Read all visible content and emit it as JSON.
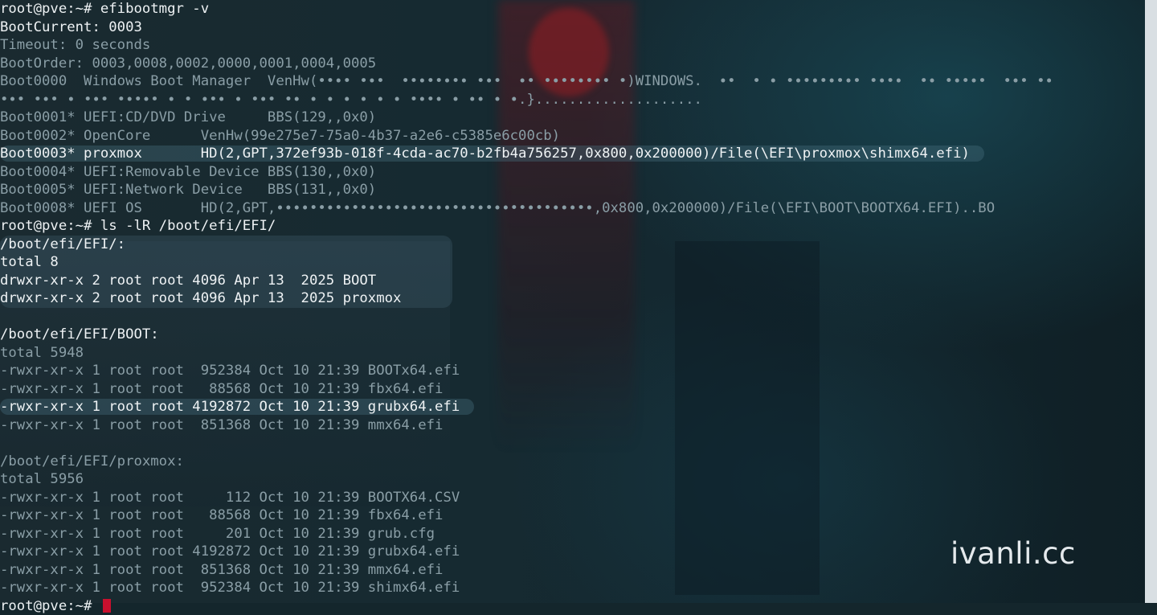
{
  "terminal": {
    "lines": [
      {
        "text": "root@pve:~# efibootmgr -v",
        "style": "bright"
      },
      {
        "text": "BootCurrent: 0003",
        "style": "bright"
      },
      {
        "text": "Timeout: 0 seconds",
        "style": "dim"
      },
      {
        "text": "BootOrder: 0003,0008,0002,0000,0001,0004,0005",
        "style": "dim"
      },
      {
        "text": "Boot0000  Windows Boot Manager  VenHw(••∙• •∙•  ••∙••∙•∙ •∙•  ∙• •∙••∙•∙• •)WINDOWS.  ∙•  • ∙ •∙•∙•∙•∙• •∙•∙  •∙ •∙•∙•  •∙• •∙",
        "style": "dim"
      },
      {
        "text": "•∙• •∙• ∙ •∙• •∙•∙• ∙ • ∙•∙ ∙ •∙• •∙ ∙ ∙ ∙ ∙ ∙ ∙ •∙•∙ ∙ ∙∙ ∙ ∙.}....................",
        "style": "dim"
      },
      {
        "text": "Boot0001* UEFI:CD/DVD Drive     BBS(129,,0x0)",
        "style": "dim"
      },
      {
        "text": "Boot0002* OpenCore      VenHw(99e275e7-75a0-4b37-a2e6-c5385e6c00cb)",
        "style": "dim"
      },
      {
        "text": "Boot0003* proxmox       HD(2,GPT,372ef93b-018f-4cda-ac70-b2fb4a756257,0x800,0x200000)/File(\\EFI\\proxmox\\shimx64.efi)",
        "style": "bright hl"
      },
      {
        "text": "Boot0004* UEFI:Removable Device BBS(130,,0x0)",
        "style": "dim"
      },
      {
        "text": "Boot0005* UEFI:Network Device   BBS(131,,0x0)",
        "style": "dim"
      },
      {
        "text": "Boot0008* UEFI OS       HD(2,GPT,∙∙∙∙••∙•∙••∙•∙•∙∙•∙∙∙•∙•∙•∙∙••∙••∙∙∙•∙,0x800,0x200000)/File(\\EFI\\BOOT\\BOOTX64.EFI)..BO",
        "style": "dim"
      },
      {
        "text": "root@pve:~# ls -lR /boot/efi/EFI/",
        "style": "bright"
      },
      {
        "text": "/boot/efi/EFI/:",
        "style": "bright"
      },
      {
        "text": "total 8",
        "style": "bright"
      },
      {
        "text": "drwxr-xr-x 2 root root 4096 Apr 13  2025 BOOT",
        "style": "bright"
      },
      {
        "text": "drwxr-xr-x 2 root root 4096 Apr 13  2025 proxmox",
        "style": "bright"
      },
      {
        "text": "",
        "style": "dim"
      },
      {
        "text": "/boot/efi/EFI/BOOT:",
        "style": "bright"
      },
      {
        "text": "total 5948",
        "style": "dim"
      },
      {
        "text": "-rwxr-xr-x 1 root root  952384 Oct 10 21:39 BOOTx64.efi",
        "style": "dim"
      },
      {
        "text": "-rwxr-xr-x 1 root root   88568 Oct 10 21:39 fbx64.efi",
        "style": "dim"
      },
      {
        "text": "-rwxr-xr-x 1 root root 4192872 Oct 10 21:39 grubx64.efi",
        "style": "bright hl"
      },
      {
        "text": "-rwxr-xr-x 1 root root  851368 Oct 10 21:39 mmx64.efi",
        "style": "dim"
      },
      {
        "text": "",
        "style": "dim"
      },
      {
        "text": "/boot/efi/EFI/proxmox:",
        "style": "dim"
      },
      {
        "text": "total 5956",
        "style": "dim"
      },
      {
        "text": "-rwxr-xr-x 1 root root     112 Oct 10 21:39 BOOTX64.CSV",
        "style": "dim"
      },
      {
        "text": "-rwxr-xr-x 1 root root   88568 Oct 10 21:39 fbx64.efi",
        "style": "dim"
      },
      {
        "text": "-rwxr-xr-x 1 root root     201 Oct 10 21:39 grub.cfg",
        "style": "dim"
      },
      {
        "text": "-rwxr-xr-x 1 root root 4192872 Oct 10 21:39 grubx64.efi",
        "style": "dim"
      },
      {
        "text": "-rwxr-xr-x 1 root root  851368 Oct 10 21:39 mmx64.efi",
        "style": "dim"
      },
      {
        "text": "-rwxr-xr-x 1 root root  952384 Oct 10 21:39 shimx64.efi",
        "style": "dim"
      }
    ],
    "prompt": "root@pve:~# ",
    "cursor_color": "#c8102e"
  },
  "watermark": "ivanli.cc",
  "colors": {
    "background": "#14262c",
    "text_bright": "#eef2f4",
    "text_dim": "#9fb1b8"
  }
}
